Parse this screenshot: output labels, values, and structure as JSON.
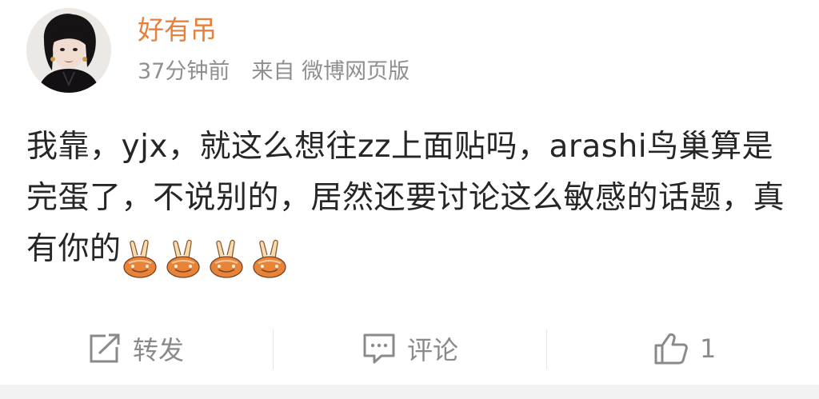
{
  "post": {
    "author": "好有吊",
    "time": "37分钟前",
    "source_prefix": "来自",
    "source": "微博网页版",
    "text": "我靠，yjx，就这么想往zz上面贴吗，arashi鸟巢算是完蛋了，不说别的，居然还要讨论这么敏感的话题，真有你的",
    "emoji_name": "peace-sign-emoji",
    "emoji_count": 4
  },
  "actions": {
    "repost_label": "转发",
    "comment_label": "评论",
    "like_count": "1"
  },
  "colors": {
    "author": "#e8803c",
    "meta": "#8f8f8f",
    "text": "#262626",
    "action": "#8a8a8a"
  }
}
